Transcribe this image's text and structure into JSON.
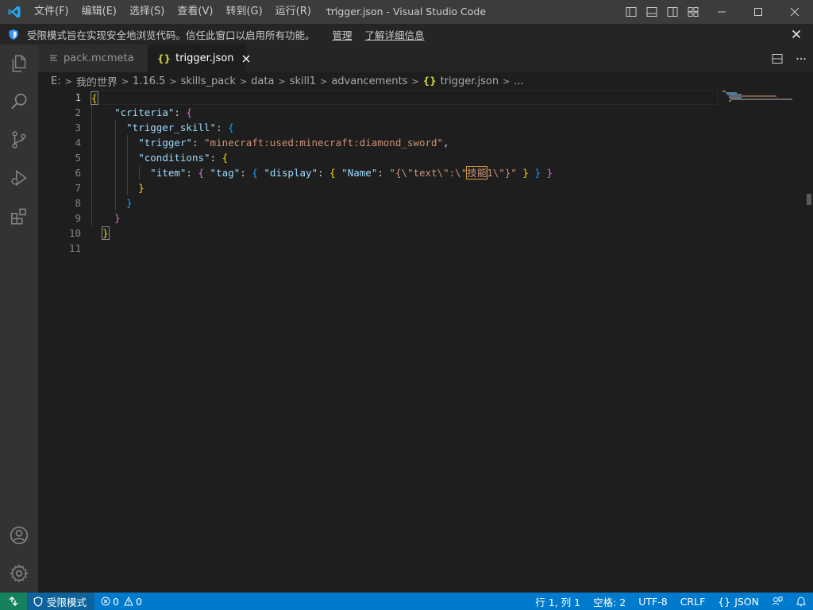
{
  "titlebar": {
    "menus": [
      {
        "label": "文件(F)"
      },
      {
        "label": "编辑(E)"
      },
      {
        "label": "选择(S)"
      },
      {
        "label": "查看(V)"
      },
      {
        "label": "转到(G)"
      },
      {
        "label": "运行(R)"
      }
    ],
    "more": "···",
    "window_title": "trigger.json - Visual Studio Code"
  },
  "banner": {
    "message": "受限模式旨在实现安全地浏览代码。信任此窗口以启用所有功能。",
    "manage_link": "管理",
    "details_link": "了解详细信息"
  },
  "tabs": [
    {
      "label": "pack.mcmeta",
      "icon": "lines-icon",
      "active": false
    },
    {
      "label": "trigger.json",
      "icon": "json-braces-icon",
      "active": true
    }
  ],
  "breadcrumb": {
    "segments": [
      "E:",
      "我的世界",
      "1.16.5",
      "skills_pack",
      "data",
      "skill1",
      "advancements"
    ],
    "file_icon": "{}",
    "file": "trigger.json",
    "ellipsis": "..."
  },
  "editor": {
    "line_numbers": [
      "1",
      "2",
      "3",
      "4",
      "5",
      "6",
      "7",
      "8",
      "9",
      "10",
      "11"
    ],
    "current_line": 1,
    "tokens": {
      "criteria": "\"criteria\"",
      "trigger_skill": "\"trigger_skill\"",
      "trigger": "\"trigger\"",
      "trigger_value": "\"minecraft:used:minecraft:diamond_sword\"",
      "conditions": "\"conditions\"",
      "item": "\"item\"",
      "tag": "\"tag\"",
      "display": "\"display\"",
      "name": "\"Name\"",
      "name_value_pre": "\"{\\\"text\\\":\\\"",
      "name_value_hl": "技能",
      "name_value_post": "1\\\"}\""
    }
  },
  "statusbar": {
    "restricted": "受限模式",
    "errors": "0",
    "warnings": "0",
    "position": "行 1, 列 1",
    "indent": "空格: 2",
    "encoding": "UTF-8",
    "eol": "CRLF",
    "language_icon": "{}",
    "language": "JSON"
  },
  "colors": {
    "accent": "#007acc",
    "restricted_bg": "#0e639c",
    "remote_bg": "#16825d"
  }
}
